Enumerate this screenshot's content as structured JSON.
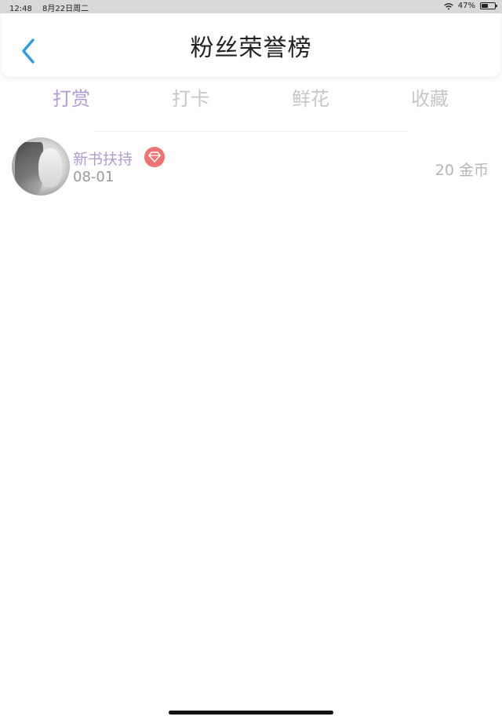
{
  "status_bar": {
    "time": "12:48",
    "date": "8月22日周二",
    "battery": "47%",
    "battery_level": 0.47,
    "wifi_icon": "wifi-icon",
    "battery_icon": "battery-icon"
  },
  "header": {
    "title": "粉丝荣誉榜",
    "back_icon": "chevron-left-icon",
    "back_color": "#2f9be8"
  },
  "tabs": [
    {
      "label": "打赏",
      "active": true
    },
    {
      "label": "打卡",
      "active": false
    },
    {
      "label": "鲜花",
      "active": false
    },
    {
      "label": "收藏",
      "active": false
    }
  ],
  "colors": {
    "active_tab": "#b39bd3",
    "inactive_tab": "#c7c7c7",
    "badge": "#f07272"
  },
  "list": [
    {
      "name": "新书扶持",
      "date": "08-01",
      "amount": "20 金币",
      "badge_icon": "diamond-icon"
    }
  ]
}
